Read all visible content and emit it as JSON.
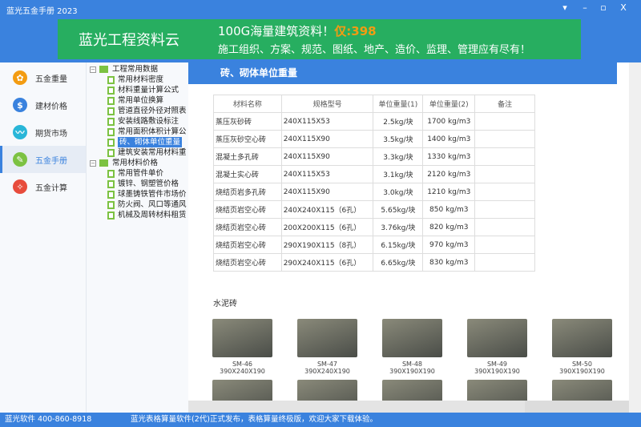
{
  "window": {
    "title": "蓝光五金手册 2023",
    "controls": [
      "▾",
      "–",
      "▫",
      "X"
    ]
  },
  "banner": {
    "brand": "蓝光工程资料云",
    "line1": "100G海量建筑资料！",
    "price": "仅:398",
    "line2": "施工组织、方案、规范、图纸、地产、造价、监理、管理应有尽有！"
  },
  "sidebar": {
    "items": [
      {
        "label": "五金重量",
        "icon": "clover-icon",
        "color": "#f39c12"
      },
      {
        "label": "建材价格",
        "icon": "dollar-icon",
        "color": "#3a82de"
      },
      {
        "label": "期货市场",
        "icon": "trend-icon",
        "color": "#29b6d8"
      },
      {
        "label": "五金手册",
        "icon": "wrench-icon",
        "color": "#7cc242",
        "active": true
      },
      {
        "label": "五金计算",
        "icon": "wand-icon",
        "color": "#e74c3c"
      }
    ]
  },
  "tree": {
    "groups": [
      {
        "label": "工程常用数据",
        "children": [
          "常用材料密度",
          "材料重量计算公式",
          "常用单位换算",
          "管道直径外径对照表",
          "安装线路敷设标注",
          "常用面积体积计算公",
          "砖、砌体单位重量",
          "建筑安装常用材料重"
        ]
      },
      {
        "label": "常用材料价格",
        "children": [
          "常用管件单价",
          "镀锌、钢塑管价格",
          "球墨铸铁管件市场价",
          "防火阀、风口等通风",
          "机械及周转材料租赁"
        ]
      }
    ],
    "selected": "砖、砌体单位重量"
  },
  "content": {
    "title": "砖、砌体单位重量",
    "table": {
      "headers": [
        "材料名称",
        "规格型号",
        "单位重量(1)",
        "单位重量(2)",
        "备注"
      ],
      "rows": [
        [
          "蒸压灰砂砖",
          "240X115X53",
          "2.5kg/块",
          "1700 kg/m3",
          ""
        ],
        [
          "蒸压灰砂空心砖",
          "240X115X90",
          "3.5kg/块",
          "1400 kg/m3",
          ""
        ],
        [
          "混凝土多孔砖",
          "240X115X90",
          "3.3kg/块",
          "1330 kg/m3",
          ""
        ],
        [
          "混凝土实心砖",
          "240X115X53",
          "3.1kg/块",
          "2120 kg/m3",
          ""
        ],
        [
          "烧结页岩多孔砖",
          "240X115X90",
          "3.0kg/块",
          "1210 kg/m3",
          ""
        ],
        [
          "烧结页岩空心砖",
          "240X240X115（6孔）",
          "5.65kg/块",
          "850 kg/m3",
          ""
        ],
        [
          "烧结页岩空心砖",
          "200X200X115（6孔）",
          "3.76kg/块",
          "820 kg/m3",
          ""
        ],
        [
          "烧结页岩空心砖",
          "290X190X115（8孔）",
          "6.15kg/块",
          "970 kg/m3",
          ""
        ],
        [
          "烧结页岩空心砖",
          "290X240X115（6孔）",
          "6.65kg/块",
          "830 kg/m3",
          ""
        ]
      ]
    },
    "subtitle": "水泥砖",
    "bricks": [
      {
        "code": "SM-46",
        "size": "390X240X190"
      },
      {
        "code": "SM-47",
        "size": "390X240X190"
      },
      {
        "code": "SM-48",
        "size": "390X190X190"
      },
      {
        "code": "SM-49",
        "size": "390X190X190"
      },
      {
        "code": "SM-50",
        "size": "390X190X190"
      }
    ]
  },
  "status": {
    "left": "蓝光软件 400-860-8918",
    "message": "蓝光表格算量软件(2代)正式发布，表格算量终极版，欢迎大家下载体验。"
  }
}
